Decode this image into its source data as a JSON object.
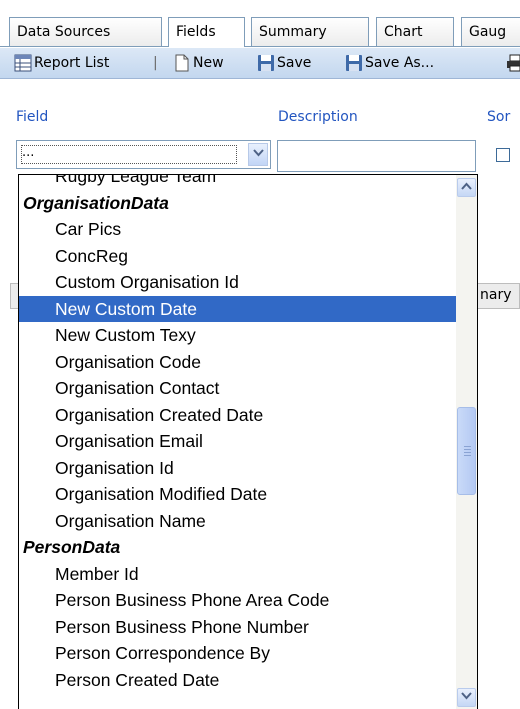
{
  "tabs": [
    {
      "label": "Data Sources",
      "active": false
    },
    {
      "label": "Fields",
      "active": true
    },
    {
      "label": "Summary",
      "active": false
    },
    {
      "label": "Chart",
      "active": false
    },
    {
      "label": "Gaug",
      "active": false
    }
  ],
  "toolbar": {
    "report_list": "Report List",
    "separator": "|",
    "new": "New",
    "save": "Save",
    "save_as": "Save As..."
  },
  "labels": {
    "field": "Field",
    "description": "Description",
    "sort": "Sor"
  },
  "field_select": {
    "value": "..."
  },
  "behind_text": "nary",
  "dropdown": {
    "items": [
      {
        "label": "Rugby League Team",
        "type": "item",
        "selected": false
      },
      {
        "label": "OrganisationData",
        "type": "group",
        "selected": false
      },
      {
        "label": "Car Pics",
        "type": "item",
        "selected": false
      },
      {
        "label": "ConcReg",
        "type": "item",
        "selected": false
      },
      {
        "label": "Custom Organisation Id",
        "type": "item",
        "selected": false
      },
      {
        "label": "New Custom Date",
        "type": "item",
        "selected": true
      },
      {
        "label": "New Custom Texy",
        "type": "item",
        "selected": false
      },
      {
        "label": "Organisation Code",
        "type": "item",
        "selected": false
      },
      {
        "label": "Organisation Contact",
        "type": "item",
        "selected": false
      },
      {
        "label": "Organisation Created Date",
        "type": "item",
        "selected": false
      },
      {
        "label": "Organisation Email",
        "type": "item",
        "selected": false
      },
      {
        "label": "Organisation Id",
        "type": "item",
        "selected": false
      },
      {
        "label": "Organisation Modified Date",
        "type": "item",
        "selected": false
      },
      {
        "label": "Organisation Name",
        "type": "item",
        "selected": false
      },
      {
        "label": "PersonData",
        "type": "group",
        "selected": false
      },
      {
        "label": "Member Id",
        "type": "item",
        "selected": false
      },
      {
        "label": "Person Business Phone Area Code",
        "type": "item",
        "selected": false
      },
      {
        "label": "Person Business Phone Number",
        "type": "item",
        "selected": false
      },
      {
        "label": "Person Correspondence By",
        "type": "item",
        "selected": false
      },
      {
        "label": "Person Created Date",
        "type": "item",
        "selected": false
      }
    ]
  },
  "colors": {
    "selection": "#3169c6",
    "label_blue": "#2255c0",
    "toolbar_top": "#dce8f6",
    "toolbar_bottom": "#c3d7ef",
    "tab_border": "#7f9db9"
  },
  "icons": {
    "report_list": "grid-list-icon",
    "new": "new-document-icon",
    "save": "floppy-disk-icon",
    "save_as": "floppy-disk-icon",
    "print": "printer-icon"
  }
}
